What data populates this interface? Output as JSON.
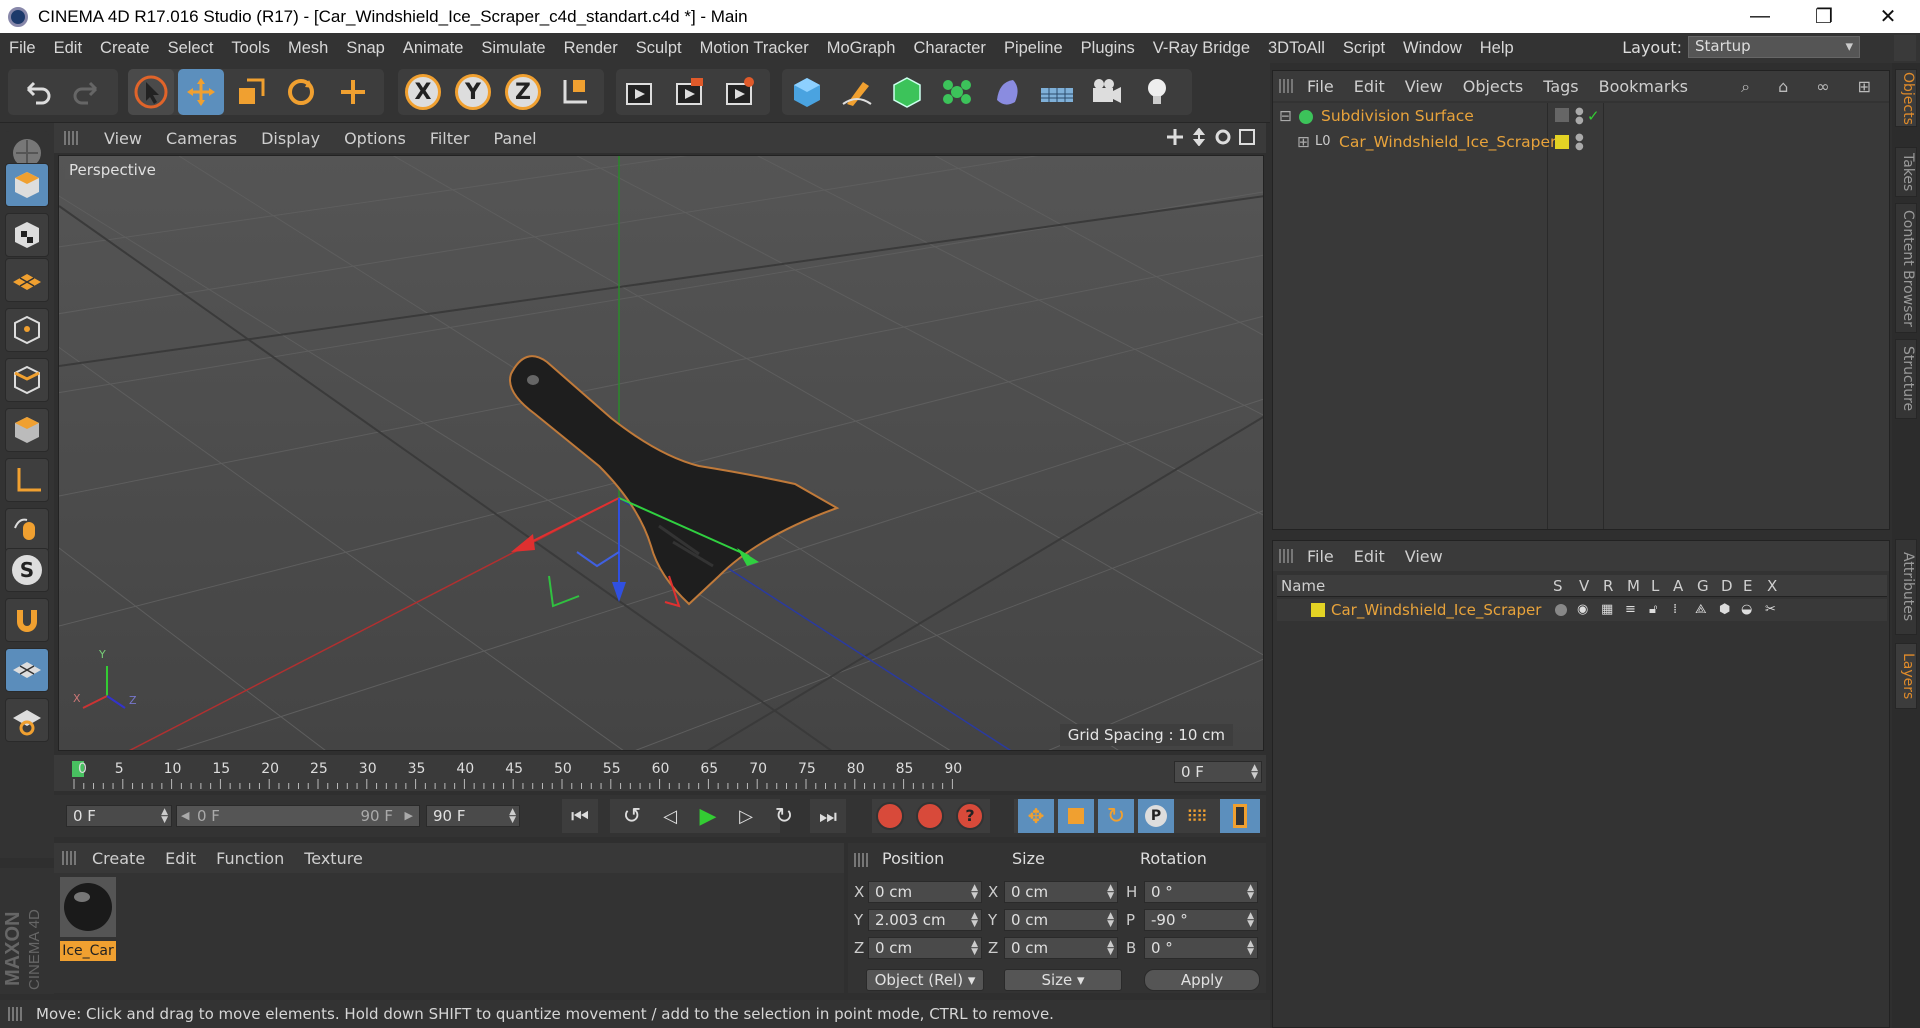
{
  "window": {
    "title": "CINEMA 4D R17.016 Studio (R17) - [Car_Windshield_Ice_Scraper_c4d_standart.c4d *] - Main",
    "minimize": "—",
    "maximize": "❐",
    "close": "✕"
  },
  "menu": [
    "File",
    "Edit",
    "Create",
    "Select",
    "Tools",
    "Mesh",
    "Snap",
    "Animate",
    "Simulate",
    "Render",
    "Sculpt",
    "Motion Tracker",
    "MoGraph",
    "Character",
    "Pipeline",
    "Plugins",
    "V-Ray Bridge",
    "3DToAll",
    "Script",
    "Window",
    "Help"
  ],
  "layout": {
    "label": "Layout:",
    "value": "Startup"
  },
  "toolbar": {
    "x": "X",
    "y": "Y",
    "z": "Z"
  },
  "left_tools": {
    "snap_letter": "S"
  },
  "viewport": {
    "menu": [
      "View",
      "Cameras",
      "Display",
      "Options",
      "Filter",
      "Panel"
    ],
    "label": "Perspective",
    "grid_spacing": "Grid Spacing : 10 cm",
    "axis": {
      "x": "X",
      "y": "Y",
      "z": "Z"
    }
  },
  "timeline": {
    "ticks": [
      "0",
      "5",
      "10",
      "15",
      "20",
      "25",
      "30",
      "35",
      "40",
      "45",
      "50",
      "55",
      "60",
      "65",
      "70",
      "75",
      "80",
      "85",
      "90"
    ],
    "current_frame": "0 F",
    "start_field": "0 F",
    "range_start": "0 F",
    "range_end": "90 F",
    "end_field": "90 F"
  },
  "material_manager": {
    "menu": [
      "Create",
      "Edit",
      "Function",
      "Texture"
    ],
    "material_name": "Ice_Car",
    "brand_line1": "MAXON",
    "brand_line2": "CINEMA 4D"
  },
  "coordinates": {
    "headers": {
      "position": "Position",
      "size": "Size",
      "rotation": "Rotation"
    },
    "rows": [
      {
        "axis": "X",
        "pos": "0 cm",
        "size_axis": "X",
        "size": "0 cm",
        "rot_axis": "H",
        "rot": "0 °"
      },
      {
        "axis": "Y",
        "pos": "2.003 cm",
        "size_axis": "Y",
        "size": "0 cm",
        "rot_axis": "P",
        "rot": "-90 °"
      },
      {
        "axis": "Z",
        "pos": "0 cm",
        "size_axis": "Z",
        "size": "0 cm",
        "rot_axis": "B",
        "rot": "0 °"
      }
    ],
    "mode": "Object (Rel)",
    "size_mode": "Size",
    "apply": "Apply"
  },
  "status": "Move: Click and drag to move elements. Hold down SHIFT to quantize movement / add to the selection in point mode, CTRL to remove.",
  "object_manager": {
    "menu": [
      "File",
      "Edit",
      "View",
      "Objects",
      "Tags",
      "Bookmarks"
    ],
    "objects": [
      {
        "name": "Subdivision Surface",
        "expand": "⊟"
      },
      {
        "name": "Car_Windshield_Ice_Scraper",
        "expand": "⊞"
      }
    ]
  },
  "layer_manager": {
    "menu": [
      "File",
      "Edit",
      "View"
    ],
    "columns": [
      "Name",
      "S",
      "V",
      "R",
      "M",
      "L",
      "A",
      "G",
      "D",
      "E",
      "X"
    ],
    "layer_name": "Car_Windshield_Ice_Scraper"
  },
  "side_tabs": [
    "Objects",
    "Takes",
    "Content Browser",
    "Structure",
    "Attributes",
    "Layers"
  ],
  "colors": {
    "accent": "#5c8fbd",
    "highlight": "#e8a33b",
    "layer_yellow": "#e3d324"
  }
}
